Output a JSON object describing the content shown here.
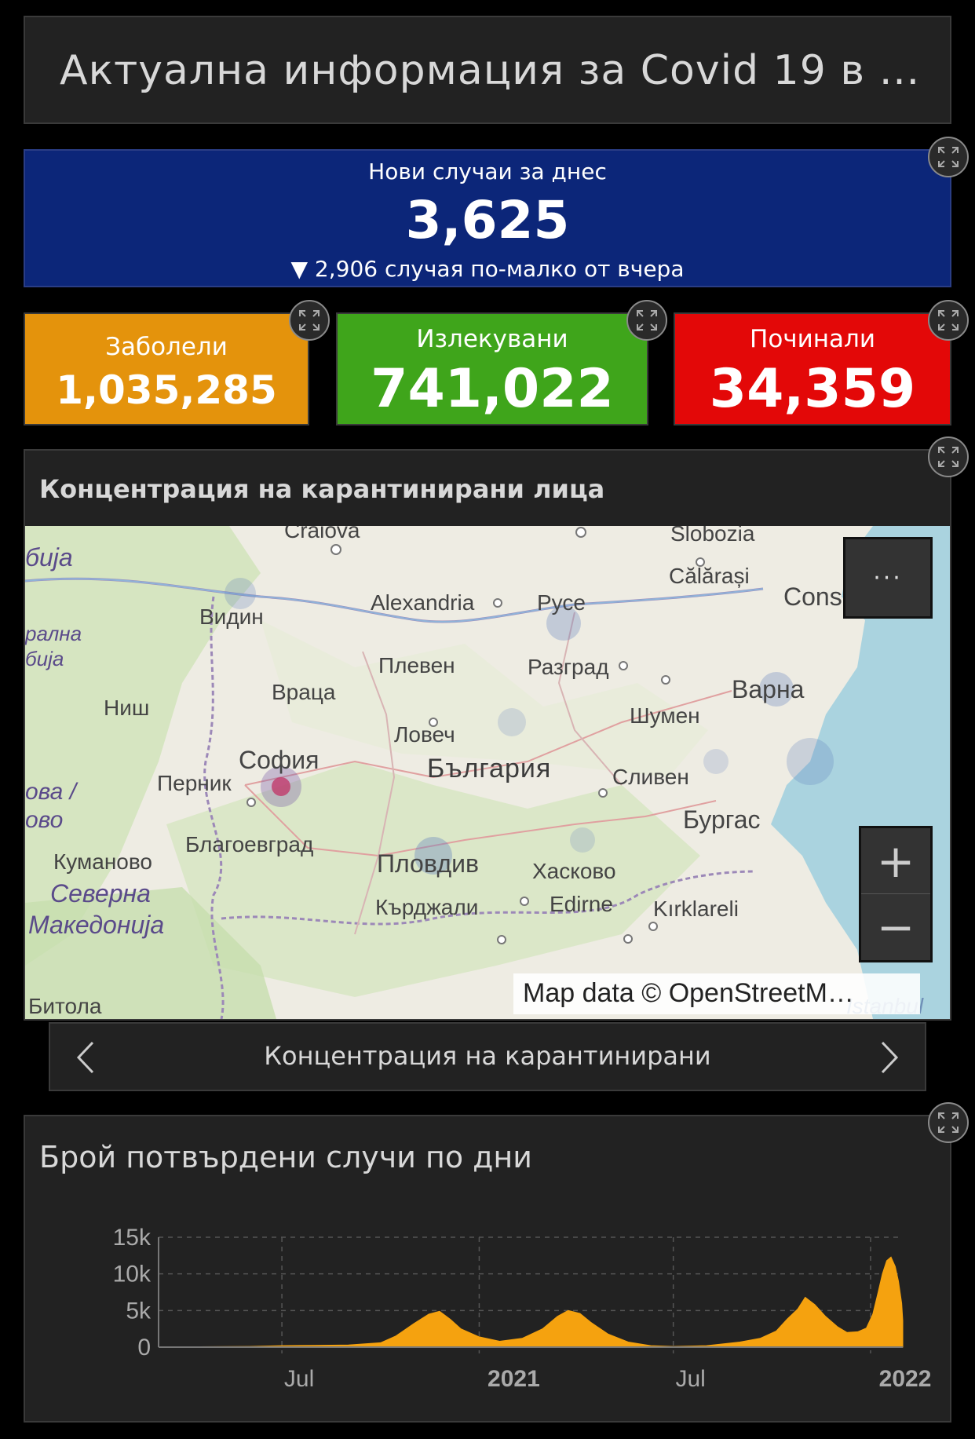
{
  "header": {
    "title": "Актуална информация за Covid 19 в …"
  },
  "new_cases": {
    "label": "Нови случаи за днес",
    "value": "3,625",
    "delta_text": "▼ 2,906 случая по-малко от вчера",
    "color": "#0c2679"
  },
  "stats": [
    {
      "label": "Заболели",
      "value": "1,035,285",
      "color": "#e4930c"
    },
    {
      "label": "Излекувани",
      "value": "741,022",
      "color": "#3fa51b"
    },
    {
      "label": "Починали",
      "value": "34,359",
      "color": "#e30808"
    }
  ],
  "map": {
    "title": "Концентрация на карантинирани лица",
    "more_label": "···",
    "zoom_in": "+",
    "zoom_out": "−",
    "attribution": "Map data © OpenStreetM…",
    "labels": [
      "Craiova",
      "Slobozia",
      "Călărași",
      "Cons",
      "Видин",
      "Alexandria",
      "Русе",
      "Плевен",
      "Разград",
      "Враца",
      "Ниш",
      "Варна",
      "Шумен",
      "Ловеч",
      "София",
      "България",
      "Сливен",
      "Перник",
      "Бургас",
      "Благоевград",
      "Пловдив",
      "Хасково",
      "Куманово",
      "Северна",
      "Македонија",
      "Кърджали",
      "Edirne",
      "Kırklareli",
      "Битола",
      "Istanbul",
      "бија",
      "ова /",
      "ово",
      "рална",
      "бија"
    ]
  },
  "map_nav": {
    "label": "Концентрация на карантинирани"
  },
  "chart_data": {
    "type": "area",
    "title": "Брой потвърдени случи по дни",
    "xlabel": "",
    "ylabel": "",
    "ylim": [
      0,
      15000
    ],
    "y_ticks": [
      "15k",
      "10k",
      "5k",
      "0"
    ],
    "x_ticks": [
      "Jul",
      "2021",
      "Jul",
      "2022"
    ],
    "x_range": [
      "2020-03-08",
      "2022-01-31"
    ],
    "color": "#f5a20f",
    "series": [
      {
        "x": [
          "2020-03-08",
          "2020-04-15",
          "2020-06-01",
          "2020-07-01",
          "2020-08-01",
          "2020-09-01",
          "2020-10-01",
          "2020-10-15",
          "2020-11-01",
          "2020-11-15",
          "2020-11-25",
          "2020-12-05",
          "2020-12-15",
          "2021-01-01",
          "2021-01-20",
          "2021-02-10",
          "2021-03-01",
          "2021-03-15",
          "2021-03-25",
          "2021-04-05",
          "2021-04-15",
          "2021-05-01",
          "2021-05-20",
          "2021-06-10",
          "2021-07-01",
          "2021-08-01",
          "2021-09-01",
          "2021-09-20",
          "2021-10-05",
          "2021-10-15",
          "2021-10-25",
          "2021-11-01",
          "2021-11-10",
          "2021-11-20",
          "2021-12-01",
          "2021-12-10",
          "2021-12-20",
          "2021-12-28",
          "2022-01-03",
          "2022-01-08",
          "2022-01-12",
          "2022-01-16",
          "2022-01-20",
          "2022-01-24",
          "2022-01-27",
          "2022-01-30",
          "2022-01-31"
        ],
        "y": [
          0,
          50,
          100,
          200,
          250,
          300,
          600,
          1500,
          3200,
          4500,
          4900,
          3800,
          2500,
          1400,
          800,
          1200,
          2500,
          4200,
          5000,
          4600,
          3400,
          1800,
          700,
          200,
          100,
          200,
          700,
          1200,
          2200,
          3800,
          5200,
          6800,
          5800,
          4200,
          2800,
          2000,
          2100,
          2600,
          4500,
          7500,
          10000,
          11800,
          12300,
          11000,
          9000,
          6000,
          3625
        ]
      }
    ]
  }
}
